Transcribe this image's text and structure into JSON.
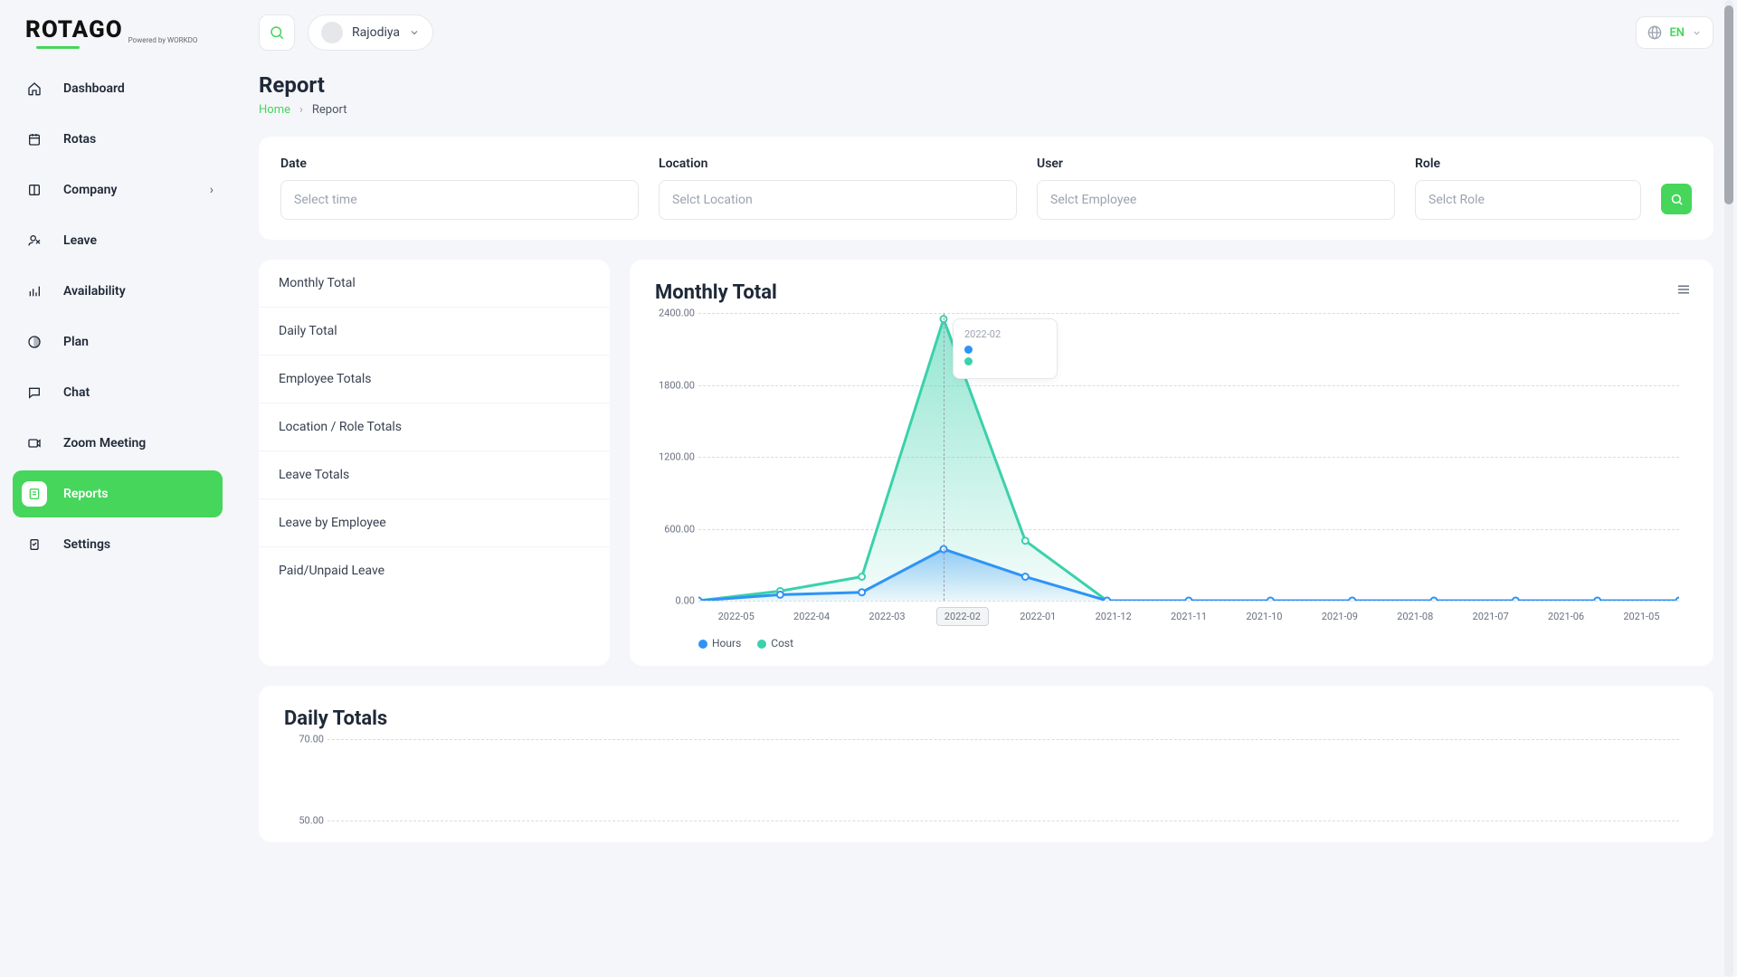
{
  "brand": {
    "name": "ROTAGO",
    "sub": "Powered by WORKDO"
  },
  "topbar": {
    "user": "Rajodiya",
    "lang": "EN"
  },
  "sidebar": {
    "items": [
      {
        "label": "Dashboard"
      },
      {
        "label": "Rotas"
      },
      {
        "label": "Company",
        "expandable": true
      },
      {
        "label": "Leave"
      },
      {
        "label": "Availability"
      },
      {
        "label": "Plan"
      },
      {
        "label": "Chat"
      },
      {
        "label": "Zoom Meeting"
      },
      {
        "label": "Reports",
        "active": true
      },
      {
        "label": "Settings"
      }
    ]
  },
  "page": {
    "title": "Report",
    "home": "Home",
    "current": "Report"
  },
  "filters": {
    "date": {
      "label": "Date",
      "placeholder": "Select time"
    },
    "location": {
      "label": "Location",
      "placeholder": "Selct Location"
    },
    "user": {
      "label": "User",
      "placeholder": "Selct Employee"
    },
    "role": {
      "label": "Role",
      "placeholder": "Selct Role"
    }
  },
  "reportTabs": [
    "Monthly Total",
    "Daily Total",
    "Employee Totals",
    "Location / Role Totals",
    "Leave Totals",
    "Leave by Employee",
    "Paid/Unpaid Leave"
  ],
  "chart1": {
    "title": "Monthly Total",
    "tooltipDate": "2022-02",
    "legend": {
      "hours": "Hours",
      "cost": "Cost"
    },
    "yTicks": [
      "0.00",
      "600.00",
      "1200.00",
      "1800.00",
      "2400.00"
    ]
  },
  "chart2": {
    "title": "Daily Totals",
    "yTicks": [
      "50.00",
      "70.00"
    ]
  },
  "colors": {
    "green": "#3bd1ab",
    "blue": "#2f93f6",
    "accent": "#45d65b"
  },
  "chart_data": {
    "type": "area",
    "title": "Monthly Total",
    "xlabel": "",
    "ylabel": "",
    "ylim": [
      0,
      2400
    ],
    "categories": [
      "2022-05",
      "2022-04",
      "2022-03",
      "2022-02",
      "2022-01",
      "2021-12",
      "2021-11",
      "2021-10",
      "2021-09",
      "2021-08",
      "2021-07",
      "2021-06",
      "2021-05"
    ],
    "series": [
      {
        "name": "Hours",
        "values": [
          0,
          50,
          70,
          430,
          200,
          0,
          0,
          0,
          0,
          0,
          0,
          0,
          0
        ]
      },
      {
        "name": "Cost",
        "values": [
          0,
          80,
          200,
          2350,
          500,
          0,
          0,
          0,
          0,
          0,
          0,
          0,
          0
        ]
      }
    ]
  }
}
